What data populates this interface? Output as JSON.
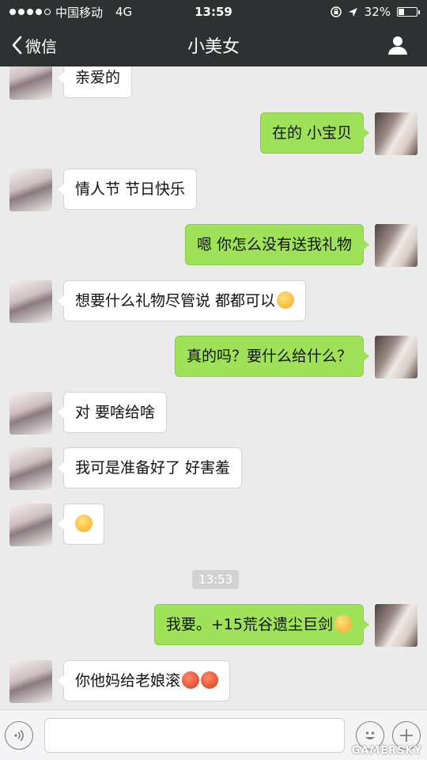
{
  "status_bar": {
    "carrier": "中国移动",
    "network": "4G",
    "time": "13:59",
    "battery": "32%",
    "battery_level": 0.32
  },
  "nav": {
    "back_label": "微信",
    "title": "小美女"
  },
  "messages": [
    {
      "side": "left",
      "text": "亲爱的"
    },
    {
      "side": "right",
      "text": "在的 小宝贝"
    },
    {
      "side": "left",
      "text": "情人节 节日快乐"
    },
    {
      "side": "right",
      "text": "嗯 你怎么没有送我礼物"
    },
    {
      "side": "left",
      "text": "想要什么礼物尽管说 都都可以",
      "emoji": "smile"
    },
    {
      "side": "right",
      "text": "真的吗？要什么给什么？"
    },
    {
      "side": "left",
      "text": "对 要啥给啥"
    },
    {
      "side": "left",
      "text": "我可是准备好了 好害羞"
    },
    {
      "side": "left",
      "text": "",
      "emoji": "wink"
    },
    {
      "side": "right",
      "text": "我要。+15荒谷遗尘巨剑",
      "emoji": "grin"
    },
    {
      "side": "left",
      "text": "你他妈给老娘滚",
      "emoji": "angry-x2"
    }
  ],
  "timestamp": "13:53",
  "input": {
    "value": "",
    "placeholder": ""
  },
  "watermark": "GAMERSKY",
  "colors": {
    "header_bg": "#2e3132",
    "chat_bg": "#ebebeb",
    "sent_bubble": "#9fe25a",
    "received_bubble": "#ffffff"
  }
}
